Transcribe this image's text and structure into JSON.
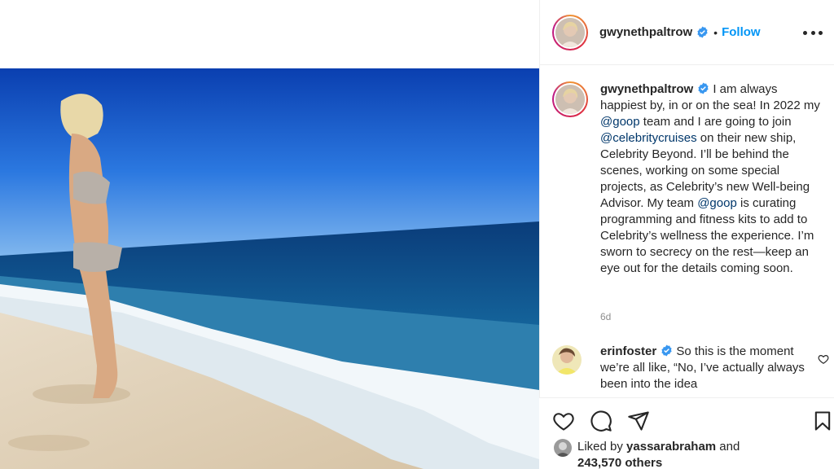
{
  "post": {
    "author": "gwynethpaltrow",
    "follow_label": "Follow",
    "dot": "•"
  },
  "caption": {
    "author": "gwynethpaltrow",
    "text_1": " I am always happiest by, in or on the sea! In 2022 my ",
    "mention_1": "@goop",
    "text_2": " team and I are going to join ",
    "mention_2": "@celebritycruises",
    "text_3": " on their new ship, Celebrity Beyond. I’ll be behind the scenes, working on some special projects, as Celebrity’s new Well-being Advisor. My team ",
    "mention_3": "@goop",
    "text_4": " is curating programming and fitness kits to add to Celebrity’s wellness the experience. I’m  sworn to secrecy on the rest—keep an eye out for the details coming soon.",
    "time": "6d"
  },
  "comment": {
    "author": "erinfoster",
    "text": " So this is the moment we’re all like, “No, I’ve actually always been into the idea"
  },
  "likes": {
    "prefix": "Liked by ",
    "user": "yassarabraham",
    "middle": " and ",
    "count": "243,570 others"
  },
  "icons": {
    "like": "heart-icon",
    "comment": "comment-icon",
    "share": "paper-plane-icon",
    "save": "bookmark-icon",
    "verified": "verified-badge-icon",
    "more": "more-options-icon"
  },
  "colors": {
    "accent": "#0095f6",
    "mention": "#00376b",
    "verified": "#3897f0",
    "sky": "#1a5fcc",
    "sea": "#0d4d86"
  }
}
